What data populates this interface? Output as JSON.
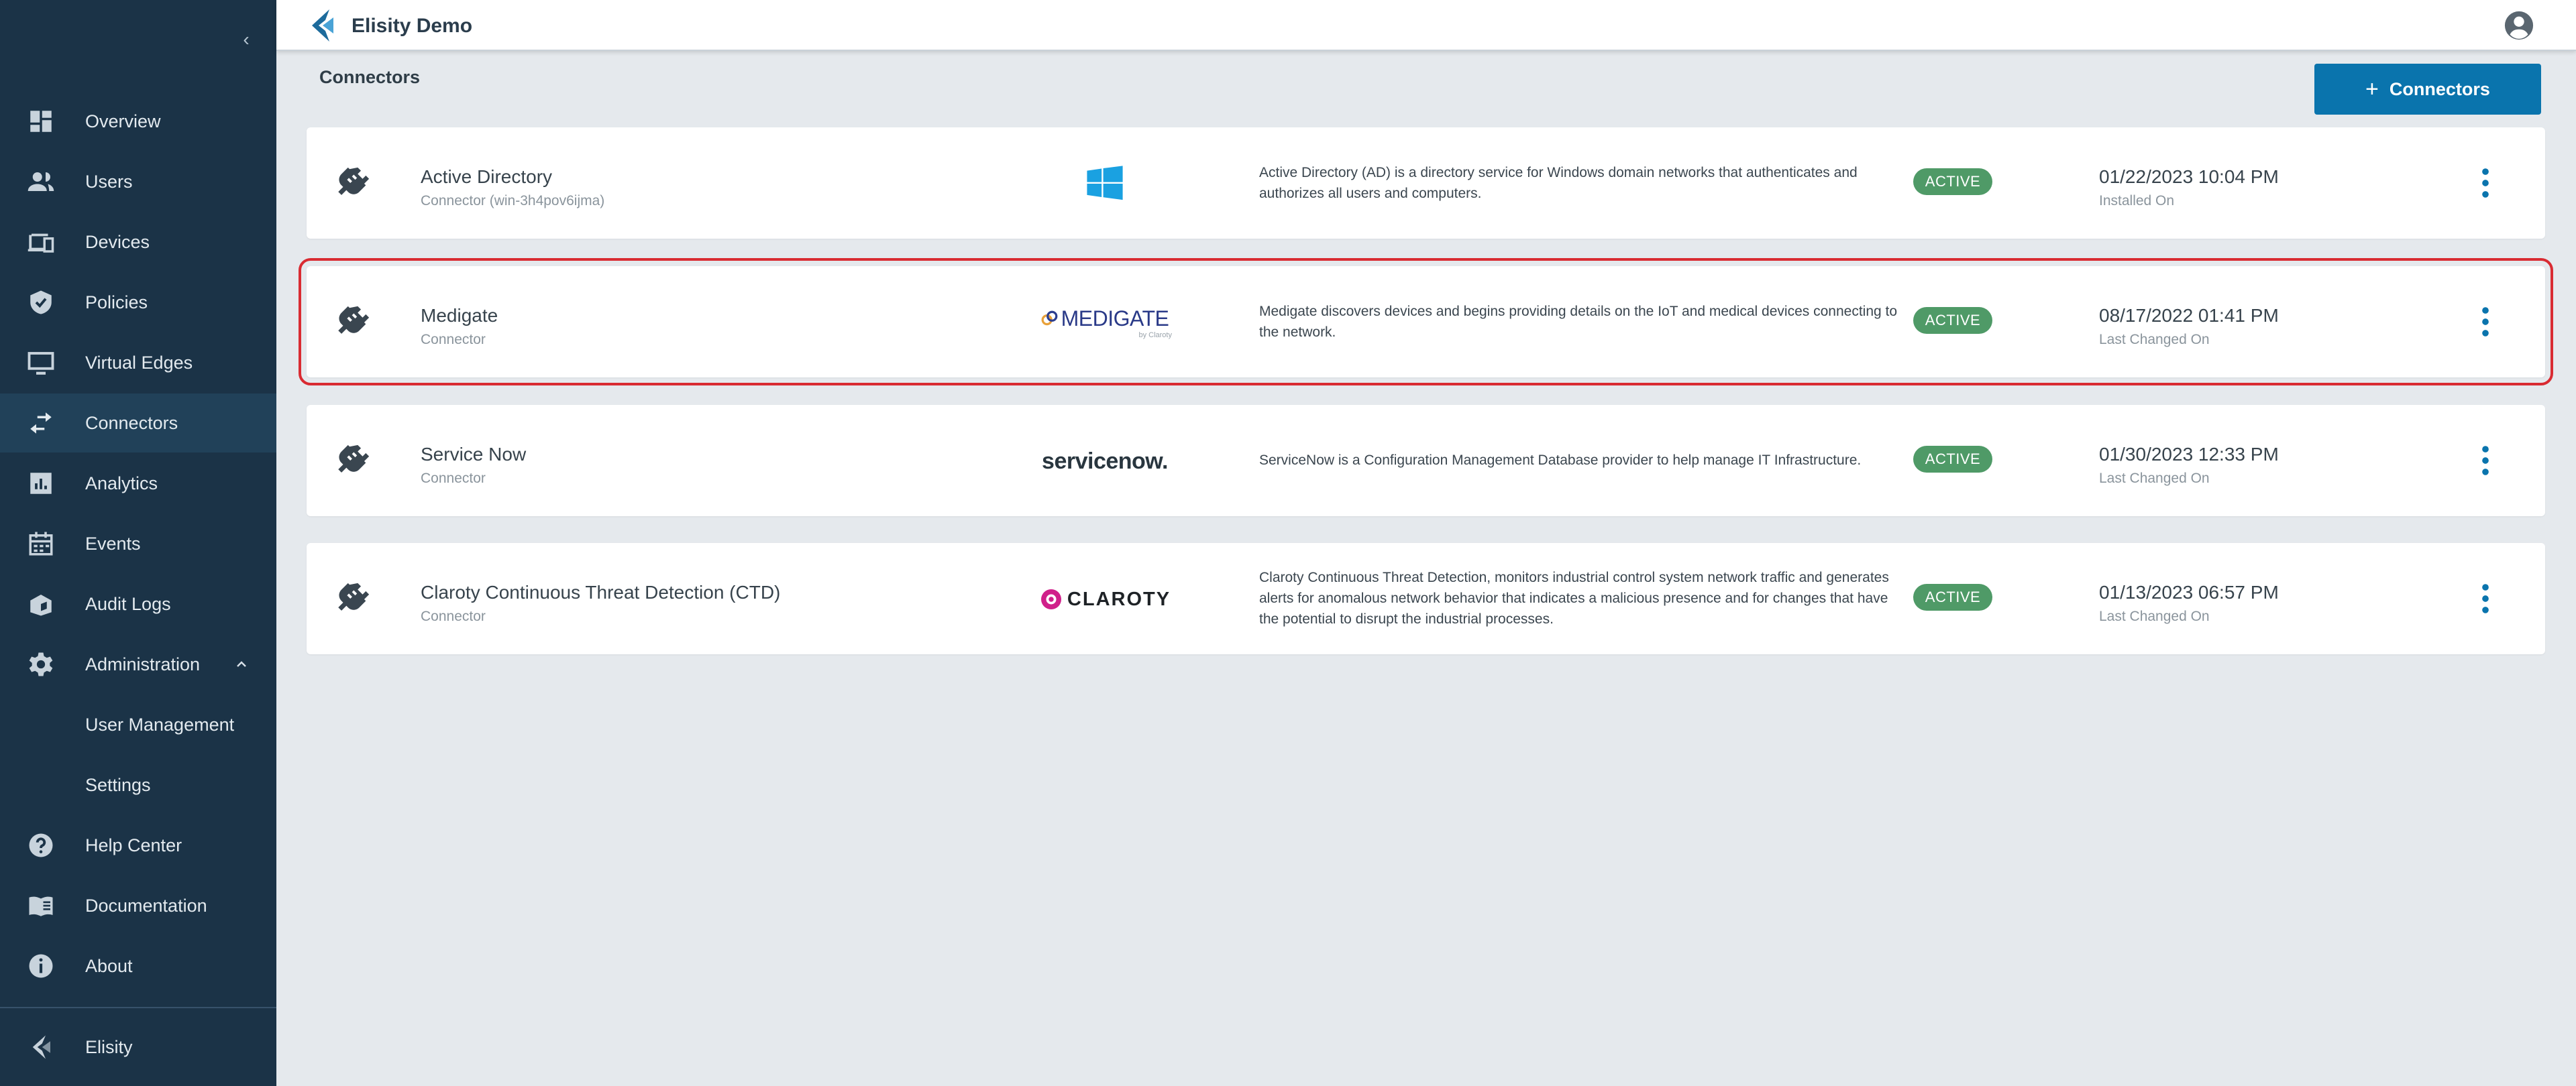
{
  "app": {
    "title": "Elisity Demo"
  },
  "sidebar": {
    "collapse_glyph": "‹",
    "items": [
      {
        "label": "Overview",
        "icon": "dashboard-icon"
      },
      {
        "label": "Users",
        "icon": "users-icon"
      },
      {
        "label": "Devices",
        "icon": "devices-icon"
      },
      {
        "label": "Policies",
        "icon": "shield-icon"
      },
      {
        "label": "Virtual Edges",
        "icon": "monitor-icon"
      },
      {
        "label": "Connectors",
        "icon": "swap-arrows-icon",
        "active": true
      },
      {
        "label": "Analytics",
        "icon": "bar-chart-icon"
      },
      {
        "label": "Events",
        "icon": "calendar-icon"
      },
      {
        "label": "Audit Logs",
        "icon": "audit-icon"
      },
      {
        "label": "Administration",
        "icon": "gear-icon",
        "expanded": true
      },
      {
        "label": "User Management",
        "sub": true
      },
      {
        "label": "Settings",
        "sub": true
      },
      {
        "label": "Help Center",
        "icon": "help-icon"
      },
      {
        "label": "Documentation",
        "icon": "book-icon"
      },
      {
        "label": "About",
        "icon": "info-icon"
      }
    ],
    "footer_label": "Elisity"
  },
  "page": {
    "title": "Connectors",
    "add_button_label": "Connectors",
    "add_button_glyph": "+"
  },
  "connectors": [
    {
      "name": "Active Directory",
      "subtitle": "Connector (win-3h4pov6ijma)",
      "logo": "windows-logo",
      "description": "Active Directory (AD) is a directory service for Windows domain networks that authenticates and authorizes all users and computers.",
      "status": "ACTIVE",
      "date": "01/22/2023 10:04 PM",
      "date_label": "Installed On"
    },
    {
      "name": "Medigate",
      "subtitle": "Connector",
      "logo": "medigate-logo",
      "logo_text": "MEDIGATE",
      "logo_subtext": "by Claroty",
      "description": "Medigate discovers devices and begins providing details on the IoT and medical devices connecting to the network.",
      "status": "ACTIVE",
      "date": "08/17/2022 01:41 PM",
      "date_label": "Last Changed On",
      "highlighted": true
    },
    {
      "name": "Service Now",
      "subtitle": "Connector",
      "logo": "servicenow-logo",
      "logo_text": "servicenow.",
      "description": "ServiceNow is a Configuration Management Database provider to help manage IT Infrastructure.",
      "status": "ACTIVE",
      "date": "01/30/2023 12:33 PM",
      "date_label": "Last Changed On"
    },
    {
      "name": "Claroty Continuous Threat Detection (CTD)",
      "subtitle": "Connector",
      "logo": "claroty-logo",
      "logo_text": "CLAROTY",
      "description": "Claroty Continuous Threat Detection, monitors industrial control system network traffic and generates alerts for anomalous network behavior that indicates a malicious presence and for changes that have the potential to disrupt the industrial processes.",
      "status": "ACTIVE",
      "date": "01/13/2023 06:57 PM",
      "date_label": "Last Changed On"
    }
  ],
  "colors": {
    "sidebar_bg": "#1b3347",
    "sidebar_active": "#214159",
    "primary": "#0a74ad",
    "active_badge": "#4f9a67",
    "highlight": "#d92b32",
    "page_bg": "#e5e9ed"
  }
}
